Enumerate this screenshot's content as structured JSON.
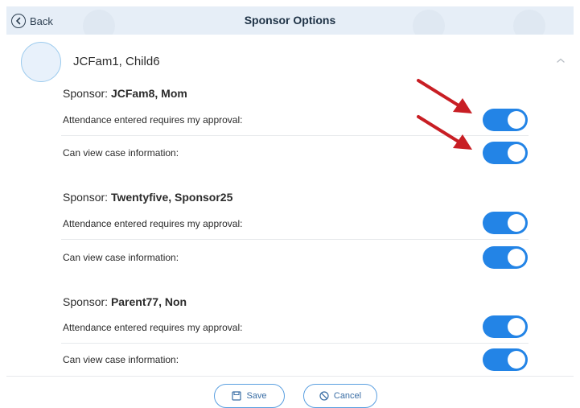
{
  "header": {
    "back_label": "Back",
    "title": "Sponsor Options"
  },
  "child": {
    "name": "JCFam1, Child6"
  },
  "sponsors": [
    {
      "prefix": "Sponsor: ",
      "name": "JCFam8, Mom",
      "settings": [
        {
          "label": "Attendance entered requires my approval:",
          "enabled": true
        },
        {
          "label": "Can view case information:",
          "enabled": true
        }
      ]
    },
    {
      "prefix": "Sponsor: ",
      "name": "Twentyfive, Sponsor25",
      "settings": [
        {
          "label": "Attendance entered requires my approval:",
          "enabled": true
        },
        {
          "label": "Can view case information:",
          "enabled": true
        }
      ]
    },
    {
      "prefix": "Sponsor: ",
      "name": "Parent77, Non",
      "settings": [
        {
          "label": "Attendance entered requires my approval:",
          "enabled": true
        },
        {
          "label": "Can view case information:",
          "enabled": true
        }
      ]
    }
  ],
  "footer": {
    "save_label": "Save",
    "cancel_label": "Cancel"
  },
  "colors": {
    "toggle_on": "#2384e6",
    "annotation_arrow": "#c81e24",
    "header_bg": "#e6eef7"
  }
}
